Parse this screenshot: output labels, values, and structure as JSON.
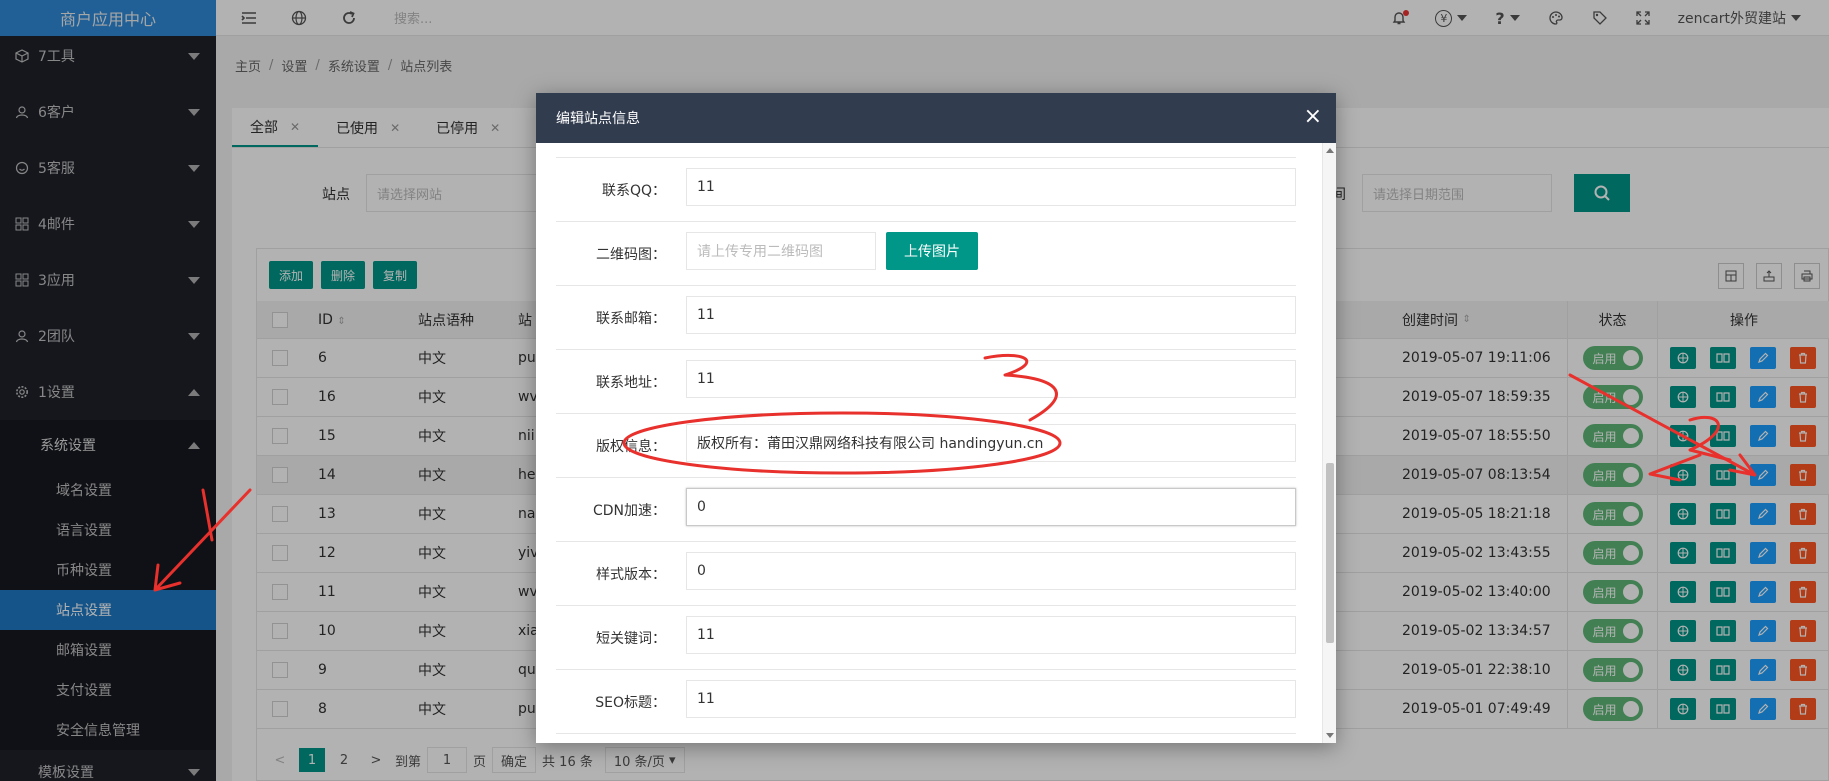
{
  "sidebar": {
    "logo": "商户应用中心",
    "groups": [
      {
        "label": "7工具"
      },
      {
        "label": "6客户"
      },
      {
        "label": "5客服"
      },
      {
        "label": "4邮件"
      },
      {
        "label": "3应用"
      },
      {
        "label": "2团队"
      },
      {
        "label": "1设置"
      }
    ],
    "subgroup_title": "系统设置",
    "items": [
      "域名设置",
      "语言设置",
      "币种设置",
      "站点设置",
      "邮箱设置",
      "支付设置",
      "安全信息管理"
    ],
    "active_item": "站点设置",
    "next_group": "模板设置"
  },
  "topbar": {
    "search_placeholder": "搜索...",
    "currency": "¥",
    "help": "?",
    "site_name": "zencart外贸建站"
  },
  "breadcrumb": [
    "主页",
    "设置",
    "系统设置",
    "站点列表"
  ],
  "tabs": [
    {
      "label": "全部",
      "active": true
    },
    {
      "label": "已使用",
      "active": false
    },
    {
      "label": "已停用",
      "active": false
    }
  ],
  "filter": {
    "site_label": "站点",
    "site_placeholder": "请选择网站",
    "time_label_partial": "间",
    "date_placeholder": "请选择日期范围"
  },
  "toolbar": {
    "add": "添加",
    "delete": "删除",
    "copy": "复制"
  },
  "table": {
    "headers": {
      "id": "ID",
      "lang": "站点语种",
      "site": "站",
      "created": "创建时间",
      "status": "状态",
      "ops": "操作"
    },
    "rows": [
      {
        "id": "6",
        "lang": "中文",
        "site": "pu",
        "created": "2019-05-07 19:11:06",
        "status": "启用"
      },
      {
        "id": "16",
        "lang": "中文",
        "site": "wv",
        "created": "2019-05-07 18:59:35",
        "status": "启用"
      },
      {
        "id": "15",
        "lang": "中文",
        "site": "nii",
        "created": "2019-05-07 18:55:50",
        "status": "启用"
      },
      {
        "id": "14",
        "lang": "中文",
        "site": "he",
        "created": "2019-05-07 08:13:54",
        "status": "启用"
      },
      {
        "id": "13",
        "lang": "中文",
        "site": "na",
        "created": "2019-05-05 18:21:18",
        "status": "启用"
      },
      {
        "id": "12",
        "lang": "中文",
        "site": "yiv",
        "created": "2019-05-02 13:43:55",
        "status": "启用"
      },
      {
        "id": "11",
        "lang": "中文",
        "site": "wv",
        "created": "2019-05-02 13:40:00",
        "status": "启用"
      },
      {
        "id": "10",
        "lang": "中文",
        "site": "xia",
        "created": "2019-05-02 13:34:57",
        "status": "启用"
      },
      {
        "id": "9",
        "lang": "中文",
        "site": "qu",
        "created": "2019-05-01 22:38:10",
        "status": "启用"
      },
      {
        "id": "8",
        "lang": "中文",
        "site": "pu",
        "created": "2019-05-01 07:49:49",
        "status": "启用"
      }
    ]
  },
  "pager": {
    "pages": [
      "1",
      "2"
    ],
    "goto_label": "到第",
    "goto_value": "1",
    "page_unit": "页",
    "confirm": "确定",
    "total": "共 16 条",
    "per_page": "10 条/页"
  },
  "modal": {
    "title": "编辑站点信息",
    "fields": [
      {
        "label": "联系QQ：",
        "value": "11"
      },
      {
        "label": "二维码图：",
        "value": "请上传专用二维码图"
      },
      {
        "label": "联系邮箱：",
        "value": "11"
      },
      {
        "label": "联系地址：",
        "value": "11"
      },
      {
        "label": "版权信息：",
        "value": "版权所有：莆田汉鼎网络科技有限公司 handingyun.cn"
      },
      {
        "label": "CDN加速：",
        "value": "0"
      },
      {
        "label": "样式版本：",
        "value": "0"
      },
      {
        "label": "短关键词：",
        "value": "11"
      },
      {
        "label": "SEO标题：",
        "value": "11"
      }
    ],
    "upload_label": "上传图片"
  },
  "colors": {
    "accent": "#009688",
    "sidebar": "#20222a",
    "active": "#1e79c4",
    "annotation": "#e8302c"
  }
}
